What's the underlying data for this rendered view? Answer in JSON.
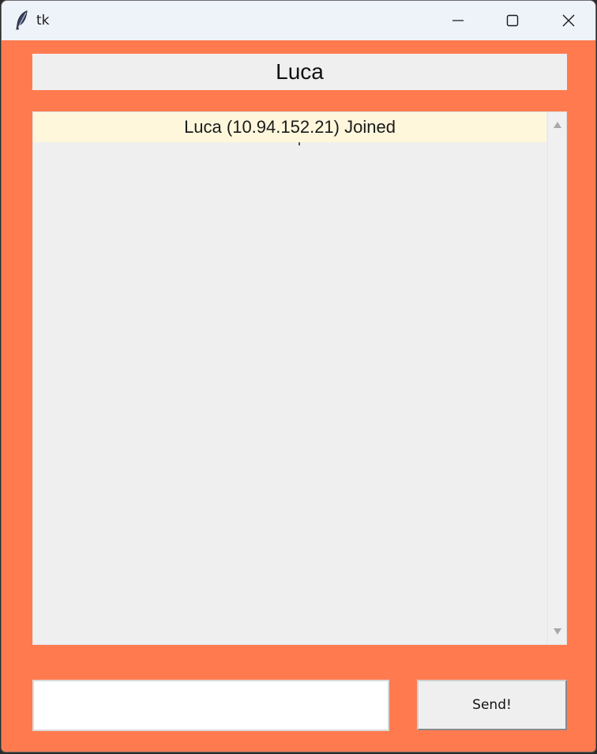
{
  "window": {
    "title": "tk",
    "icon": "feather-icon",
    "controls": [
      "minimize-icon",
      "maximize-icon",
      "close-icon"
    ]
  },
  "header": {
    "name": "Luca"
  },
  "chat": {
    "messages": [
      {
        "text": "Luca (10.94.152.21) Joined"
      }
    ]
  },
  "input": {
    "value": ""
  },
  "send": {
    "label": "Send!"
  },
  "colors": {
    "background": "#ff7b4f",
    "panel": "#efefef",
    "highlight_row": "#fff7dc",
    "titlebar": "#eef2f9"
  }
}
